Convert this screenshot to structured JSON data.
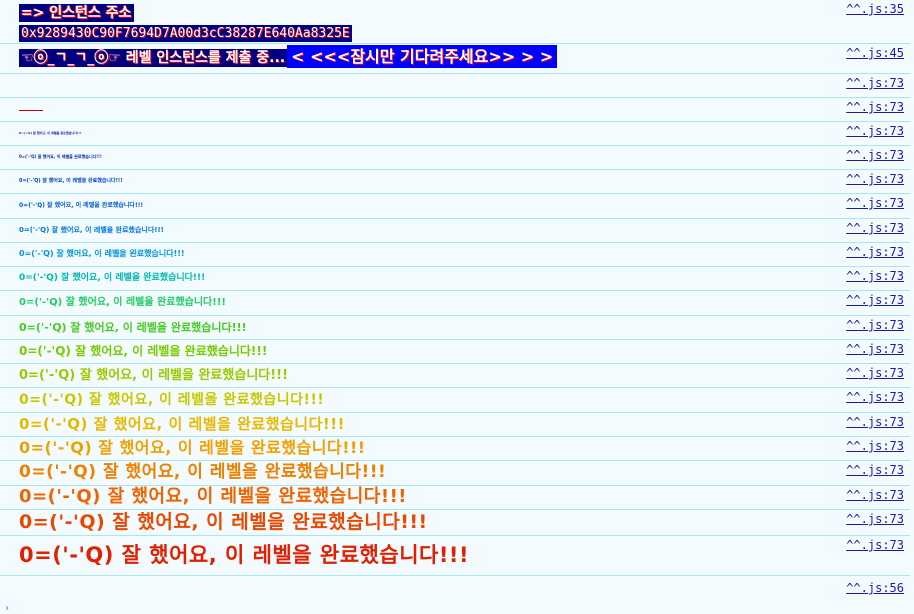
{
  "console": {
    "instance_label": "=> 인스턴스 주소",
    "instance_address": "0x9289430C90F7694D7A00d3cC38287E640Aa8325E",
    "submit_text": "☜ⓞ_ㄱ_ㄱ_ⓞ☞ 레벨 인스턴스를 제출 중...",
    "wait_text": "< <<<잠시만 기다려주세요>> > >",
    "sources": {
      "line35": "^^.js:35",
      "line45": "^^.js:45",
      "line73": "^^.js:73",
      "line56": "^^.js:56"
    },
    "success_message": "0=('-'Q) 잘 했어요, 이 레벨을 완료했습니다!!!",
    "success_rows": [
      {
        "color": "#00008b"
      },
      {
        "color": "#00008b"
      },
      {
        "color": "#0a1a9a"
      },
      {
        "color": "#0a2ab0"
      },
      {
        "color": "#0044c8"
      },
      {
        "color": "#005cd8"
      },
      {
        "color": "#0078e0"
      },
      {
        "color": "#0096d8"
      },
      {
        "color": "#00b8b0"
      },
      {
        "color": "#22cc66"
      },
      {
        "color": "#44cc22"
      },
      {
        "color": "#77cc00"
      },
      {
        "color": "#99cc00"
      },
      {
        "color": "#c8c800"
      },
      {
        "color": "#e6b800"
      },
      {
        "color": "#f0a000"
      },
      {
        "color": "#f08000"
      },
      {
        "color": "#f06400"
      },
      {
        "color": "#e84800"
      },
      {
        "color": "#e02000"
      }
    ],
    "prompt_symbol": "›"
  }
}
